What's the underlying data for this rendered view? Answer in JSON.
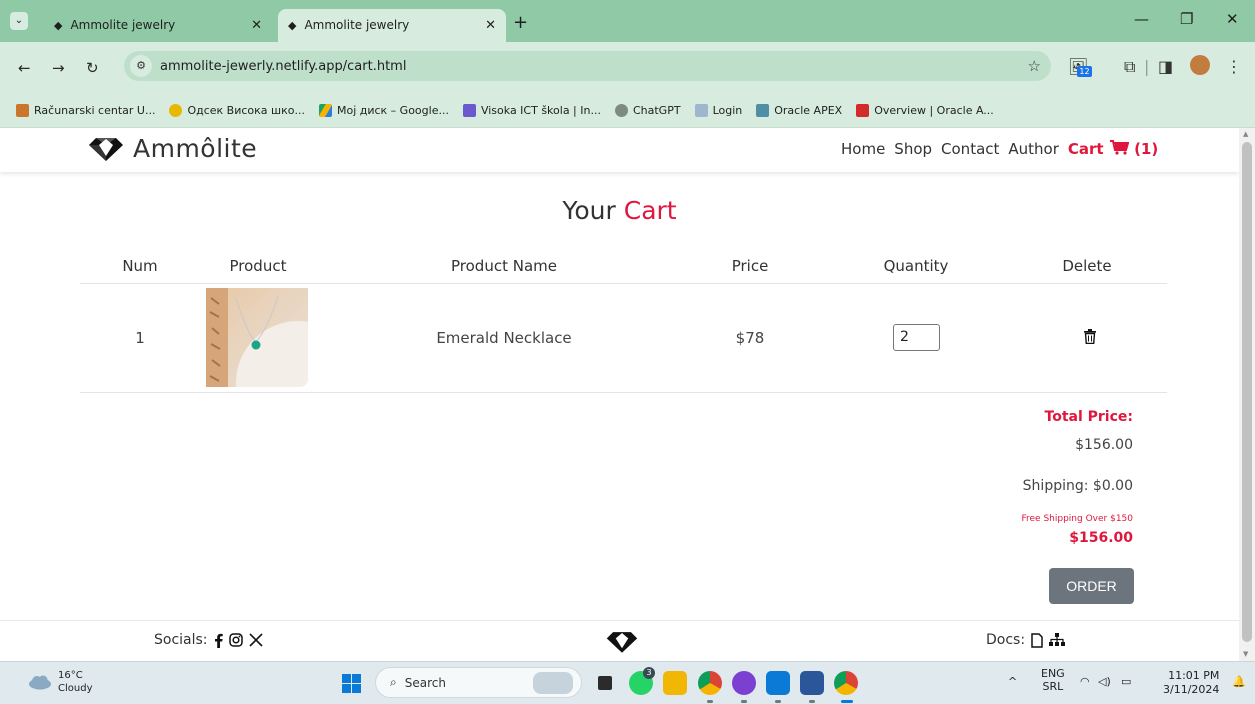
{
  "browser": {
    "tabs": [
      {
        "title": "Ammolite jewelry",
        "active": false
      },
      {
        "title": "Ammolite jewelry",
        "active": true
      }
    ],
    "url": "ammolite-jewerly.netlify.app/cart.html",
    "extension_badge": "12",
    "bookmarks": [
      {
        "label": "Računarski centar U...",
        "color": "#c8772c"
      },
      {
        "label": "Одсек Висока шко...",
        "color": "#e6b800"
      },
      {
        "label": "Мој диск – Google...",
        "color": "#1ea362"
      },
      {
        "label": "Visoka ICT škola | In...",
        "color": "#6a5acd"
      },
      {
        "label": "ChatGPT",
        "color": "#7d8b84"
      },
      {
        "label": "Login",
        "color": "#9fb6cf"
      },
      {
        "label": "Oracle APEX",
        "color": "#4f8fa6"
      },
      {
        "label": "Overview | Oracle A...",
        "color": "#d22b2b"
      }
    ]
  },
  "site": {
    "brand": "Ammôlite",
    "nav": [
      "Home",
      "Shop",
      "Contact",
      "Author"
    ],
    "cart_label": "Cart",
    "cart_count": "(1)",
    "accent_color": "#e0173d"
  },
  "cart": {
    "title_prefix": "Your",
    "title_accent": "Cart",
    "headers": {
      "num": "Num",
      "product": "Product",
      "name": "Product Name",
      "price": "Price",
      "quantity": "Quantity",
      "delete": "Delete"
    },
    "items": [
      {
        "num": "1",
        "name": "Emerald Necklace",
        "price": "$78",
        "quantity": "2"
      }
    ],
    "total_label": "Total Price:",
    "total_value": "$156.00",
    "shipping": "Shipping: $0.00",
    "free_shipping_note": "Free Shipping Over $150",
    "grand_total": "$156.00",
    "order_label": "ORDER"
  },
  "footer": {
    "socials_label": "Socials:",
    "docs_label": "Docs:"
  },
  "taskbar": {
    "temperature": "16°C",
    "weather": "Cloudy",
    "search_placeholder": "Search",
    "whatsapp_badge": "3",
    "lang_top": "ENG",
    "lang_bottom": "SRL",
    "time": "11:01 PM",
    "date": "3/11/2024"
  }
}
